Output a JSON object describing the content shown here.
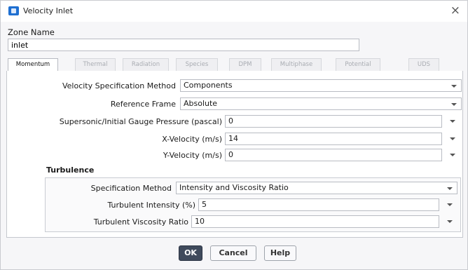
{
  "window": {
    "title": "Velocity Inlet",
    "close_symbol": "×"
  },
  "zone": {
    "label": "Zone Name",
    "value": "inlet"
  },
  "tabs": [
    "Momentum",
    "Thermal",
    "Radiation",
    "Species",
    "DPM",
    "Multiphase",
    "Potential",
    "UDS"
  ],
  "active_tab": "Momentum",
  "momentum": {
    "velocity_spec_method": {
      "label": "Velocity Specification Method",
      "value": "Components"
    },
    "reference_frame": {
      "label": "Reference Frame",
      "value": "Absolute"
    },
    "gauge_pressure": {
      "label": "Supersonic/Initial Gauge Pressure (pascal)",
      "value": "0"
    },
    "x_velocity": {
      "label": "X-Velocity (m/s)",
      "value": "14"
    },
    "y_velocity": {
      "label": "Y-Velocity (m/s)",
      "value": "0"
    }
  },
  "turbulence": {
    "heading": "Turbulence",
    "spec_method": {
      "label": "Specification Method",
      "value": "Intensity and Viscosity Ratio"
    },
    "intensity": {
      "label": "Turbulent Intensity (%)",
      "value": "5"
    },
    "viscosity_ratio": {
      "label": "Turbulent Viscosity Ratio",
      "value": "10"
    }
  },
  "buttons": {
    "ok": "OK",
    "cancel": "Cancel",
    "help": "Help"
  }
}
